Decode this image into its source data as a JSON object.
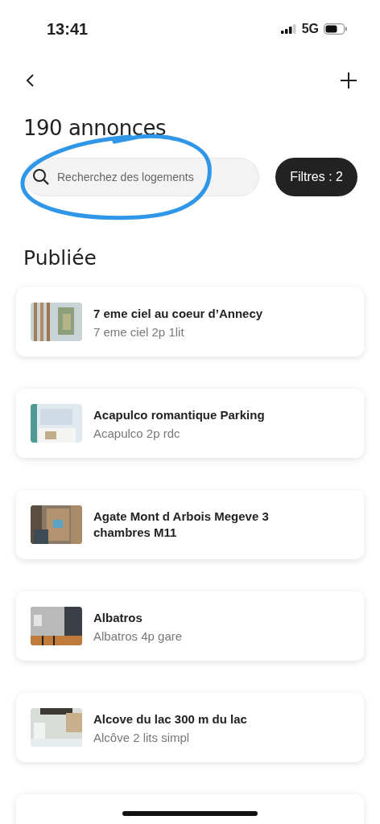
{
  "status_bar": {
    "time": "13:41",
    "network": "5G"
  },
  "header": {
    "title": "190 annonces"
  },
  "search": {
    "placeholder": "Recherchez des logements",
    "annotated": true
  },
  "filters_button": {
    "label": "Filtres : 2"
  },
  "section": {
    "title": "Publiée"
  },
  "listings": [
    {
      "title": "7 eme ciel au coeur d’Annecy",
      "subtitle": "7 eme ciel 2p 1lit"
    },
    {
      "title": "Acapulco romantique Parking",
      "subtitle": "Acapulco 2p rdc"
    },
    {
      "title": "Agate Mont d Arbois Megeve 3 chambres M11"
    },
    {
      "title": "Albatros",
      "subtitle": "Albatros 4p gare"
    },
    {
      "title": "Alcove du lac 300 m du lac",
      "subtitle": "Alcôve 2 lits simpl"
    }
  ]
}
